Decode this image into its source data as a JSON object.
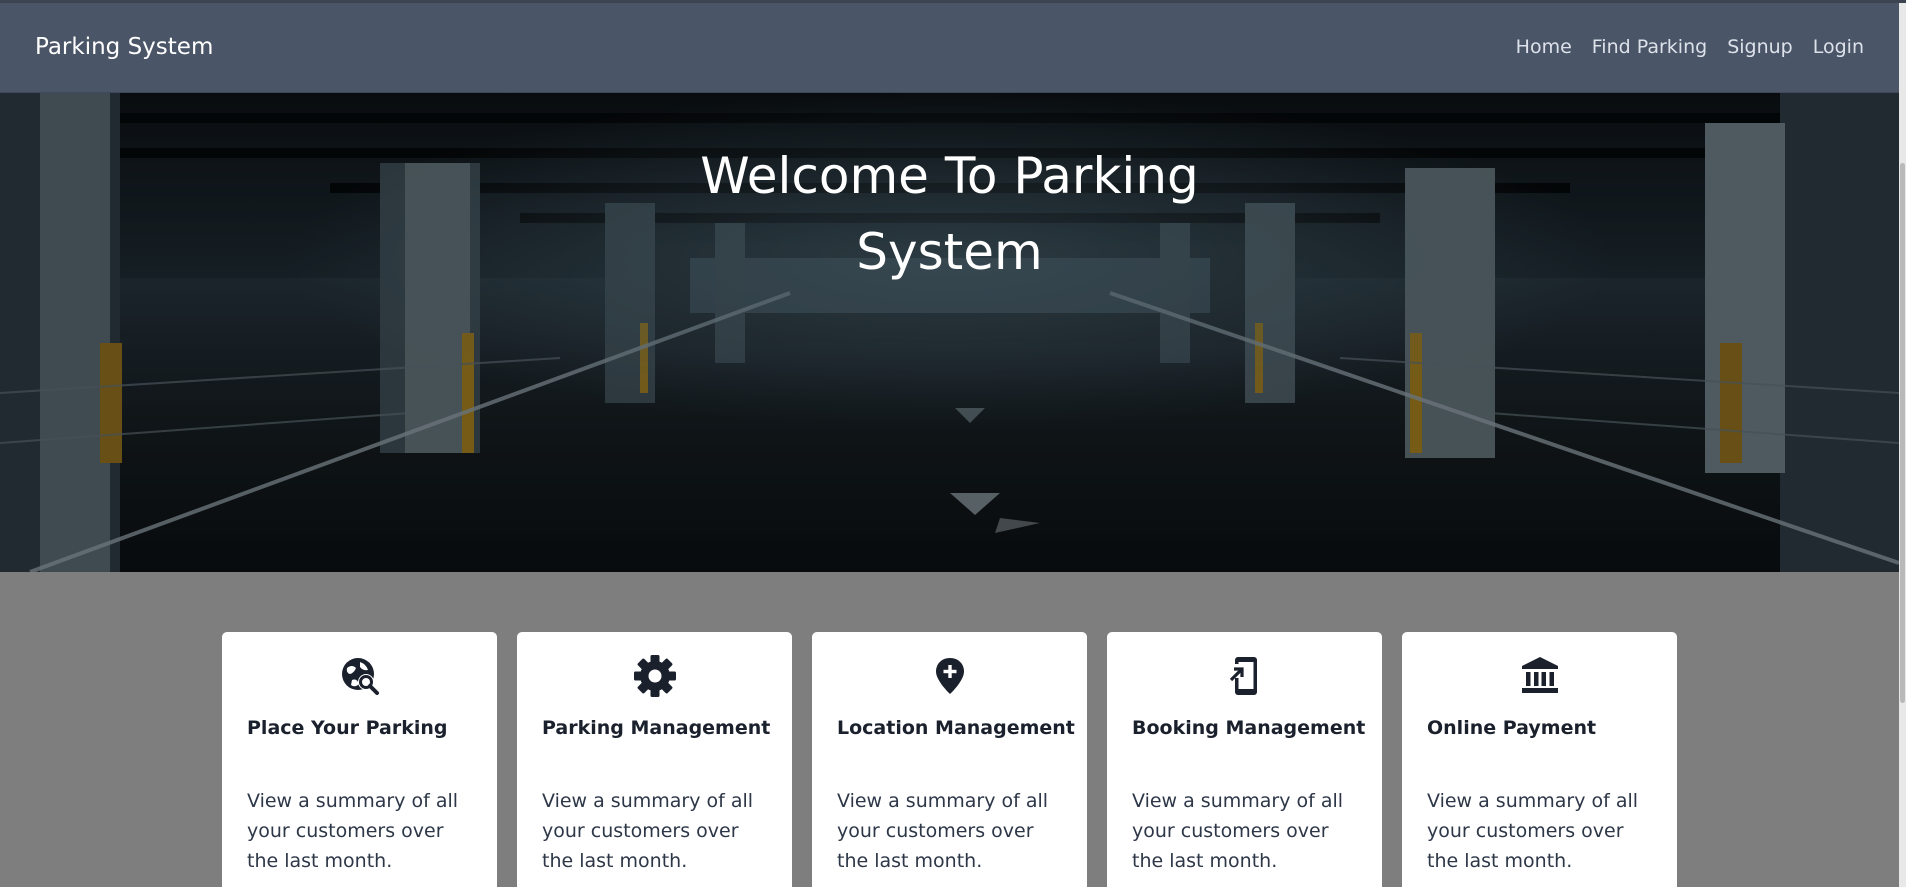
{
  "navbar": {
    "brand": "Parking System",
    "links": [
      {
        "label": "Home"
      },
      {
        "label": "Find Parking"
      },
      {
        "label": "Signup"
      },
      {
        "label": "Login"
      }
    ]
  },
  "hero": {
    "title_line1": "Welcome To Parking",
    "title_line2": "System"
  },
  "cards": [
    {
      "icon": "globe-search-icon",
      "title": "Place Your Parking",
      "text": "View a summary of all your customers over the last month."
    },
    {
      "icon": "gear-icon",
      "title": "Parking Management",
      "text": "View a summary of all your customers over the last month."
    },
    {
      "icon": "location-pin-plus-icon",
      "title": "Location Management",
      "text": "View a summary of all your customers over the last month."
    },
    {
      "icon": "mobile-booking-icon",
      "title": "Booking Management",
      "text": "View a summary of all your customers over the last month."
    },
    {
      "icon": "bank-icon",
      "title": "Online Payment",
      "text": "View a summary of all your customers over the last month."
    }
  ],
  "colors": {
    "navbar_bg": "#4a5568",
    "page_bg": "#7e7e7e",
    "card_bg": "#ffffff",
    "icon_color": "#1a202c"
  }
}
